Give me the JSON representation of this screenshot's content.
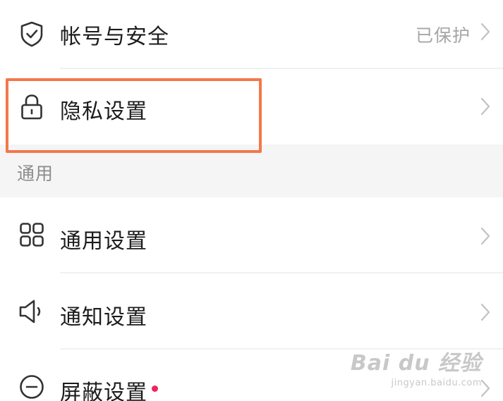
{
  "settings": {
    "account": {
      "label": "帐号与安全",
      "value": "已保护",
      "icon": "shield-check-icon"
    },
    "privacy": {
      "label": "隐私设置",
      "icon": "lock-icon"
    },
    "section_general": {
      "title": "通用"
    },
    "general": {
      "label": "通用设置",
      "icon": "grid-icon"
    },
    "notify": {
      "label": "通知设置",
      "icon": "speaker-icon"
    },
    "block": {
      "label": "屏蔽设置",
      "icon": "minus-circle-icon",
      "has_dot": true
    }
  },
  "watermark": {
    "brand": "Bai du 经验",
    "url": "jingyan.baidu.com"
  },
  "colors": {
    "highlight": "#f2784b",
    "dot": "#f0245a",
    "section_bg": "#f5f5f5"
  }
}
